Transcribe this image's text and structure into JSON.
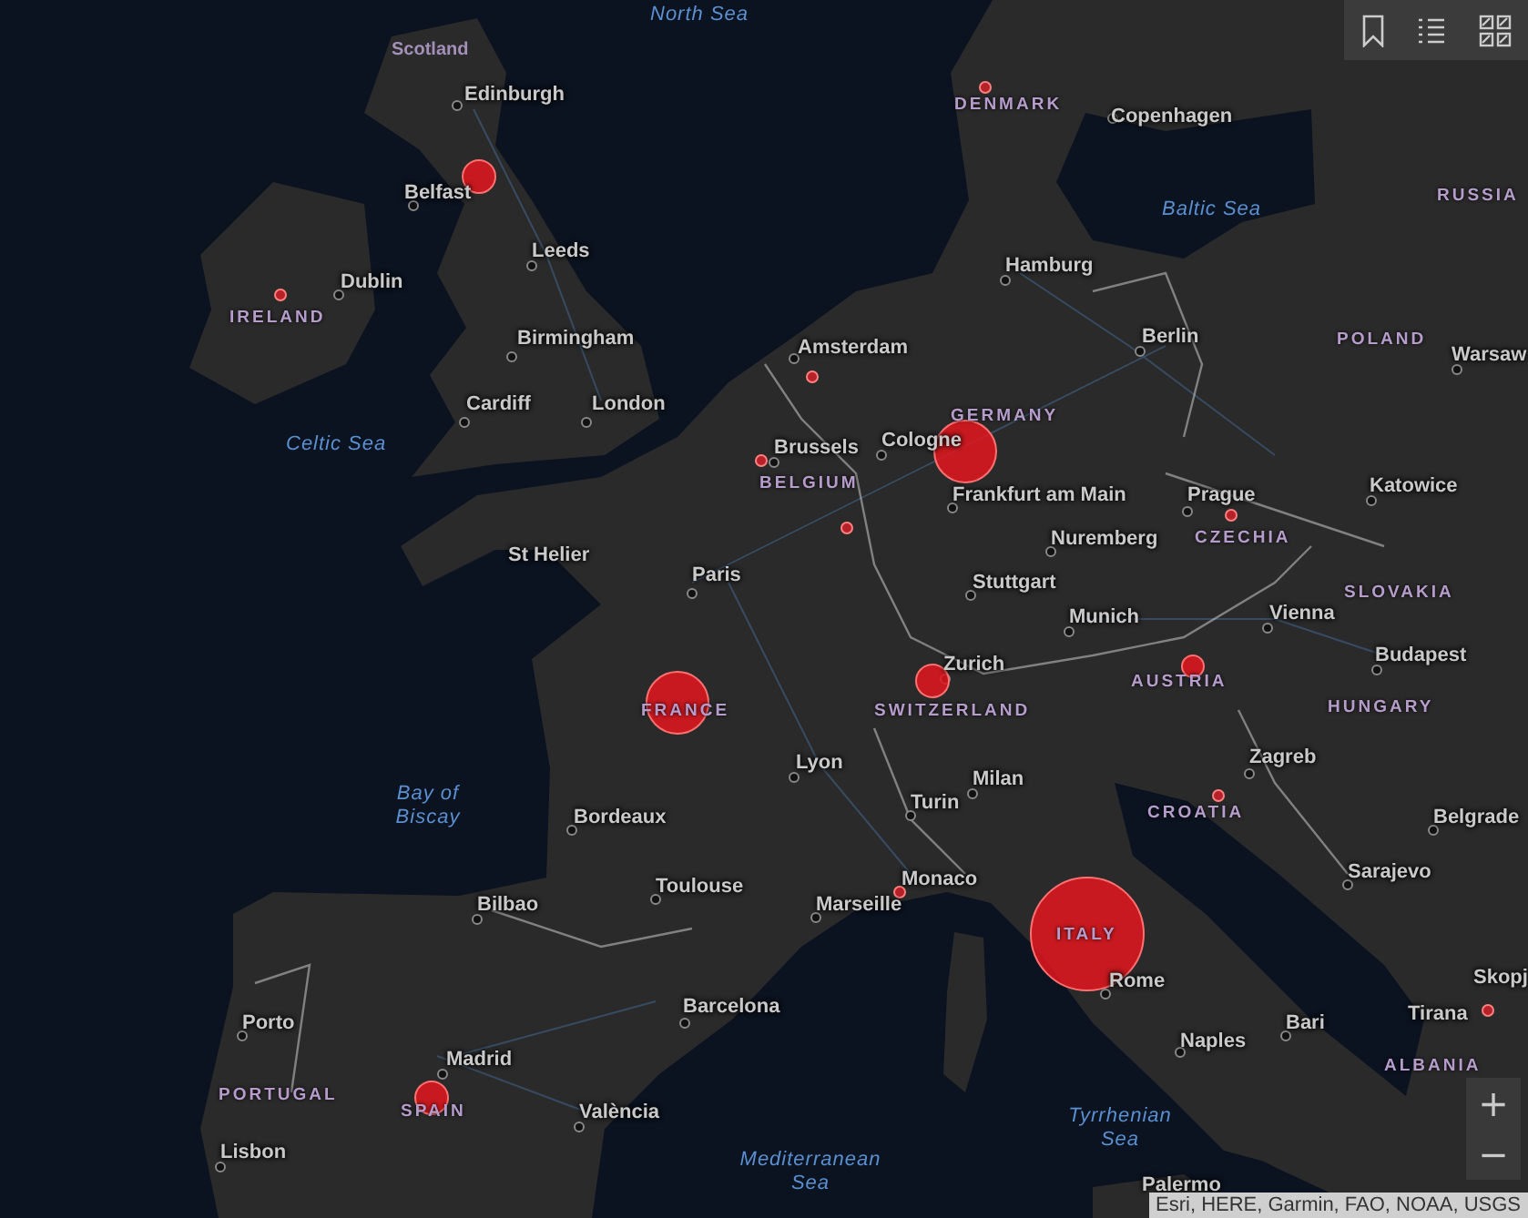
{
  "map": {
    "labels": [
      {
        "text": "North Sea",
        "kind": "sea"
      },
      {
        "text": "Scotland",
        "kind": "region"
      },
      {
        "text": "Edinburgh",
        "kind": "city"
      },
      {
        "text": "DENMARK",
        "kind": "country"
      },
      {
        "text": "Copenhagen",
        "kind": "city"
      },
      {
        "text": "Belfast",
        "kind": "city"
      },
      {
        "text": "RUSSIA",
        "kind": "country"
      },
      {
        "text": "Baltic Sea",
        "kind": "sea"
      },
      {
        "text": "Leeds",
        "kind": "city"
      },
      {
        "text": "Hamburg",
        "kind": "city"
      },
      {
        "text": "Dublin",
        "kind": "city"
      },
      {
        "text": "IRELAND",
        "kind": "country"
      },
      {
        "text": "Birmingham",
        "kind": "city"
      },
      {
        "text": "Berlin",
        "kind": "city"
      },
      {
        "text": "POLAND",
        "kind": "country"
      },
      {
        "text": "Amsterdam",
        "kind": "city"
      },
      {
        "text": "Warsaw",
        "kind": "city"
      },
      {
        "text": "Cardiff",
        "kind": "city"
      },
      {
        "text": "London",
        "kind": "city"
      },
      {
        "text": "GERMANY",
        "kind": "country"
      },
      {
        "text": "Celtic Sea",
        "kind": "sea"
      },
      {
        "text": "Brussels",
        "kind": "city"
      },
      {
        "text": "Cologne",
        "kind": "city"
      },
      {
        "text": "BELGIUM",
        "kind": "country"
      },
      {
        "text": "Katowice",
        "kind": "city"
      },
      {
        "text": "Frankfurt am Main",
        "kind": "city"
      },
      {
        "text": "Prague",
        "kind": "city"
      },
      {
        "text": "Nuremberg",
        "kind": "city"
      },
      {
        "text": "CZECHIA",
        "kind": "country"
      },
      {
        "text": "St Helier",
        "kind": "city"
      },
      {
        "text": "Paris",
        "kind": "city"
      },
      {
        "text": "Stuttgart",
        "kind": "city"
      },
      {
        "text": "SLOVAKIA",
        "kind": "country"
      },
      {
        "text": "Vienna",
        "kind": "city"
      },
      {
        "text": "Munich",
        "kind": "city"
      },
      {
        "text": "Budapest",
        "kind": "city"
      },
      {
        "text": "Zurich",
        "kind": "city"
      },
      {
        "text": "AUSTRIA",
        "kind": "country"
      },
      {
        "text": "FRANCE",
        "kind": "country"
      },
      {
        "text": "SWITZERLAND",
        "kind": "country"
      },
      {
        "text": "HUNGARY",
        "kind": "country"
      },
      {
        "text": "Zagreb",
        "kind": "city"
      },
      {
        "text": "Lyon",
        "kind": "city"
      },
      {
        "text": "Milan",
        "kind": "city"
      },
      {
        "text": "Bay of Biscay",
        "kind": "sea"
      },
      {
        "text": "Turin",
        "kind": "city"
      },
      {
        "text": "Bordeaux",
        "kind": "city"
      },
      {
        "text": "CROATIA",
        "kind": "country"
      },
      {
        "text": "Belgrade",
        "kind": "city"
      },
      {
        "text": "Sarajevo",
        "kind": "city"
      },
      {
        "text": "Monaco",
        "kind": "city"
      },
      {
        "text": "Toulouse",
        "kind": "city"
      },
      {
        "text": "Marseille",
        "kind": "city"
      },
      {
        "text": "Bilbao",
        "kind": "city"
      },
      {
        "text": "ITALY",
        "kind": "country"
      },
      {
        "text": "Skopj",
        "kind": "city"
      },
      {
        "text": "Rome",
        "kind": "city"
      },
      {
        "text": "Barcelona",
        "kind": "city"
      },
      {
        "text": "Tirana",
        "kind": "city"
      },
      {
        "text": "Porto",
        "kind": "city"
      },
      {
        "text": "Bari",
        "kind": "city"
      },
      {
        "text": "Naples",
        "kind": "city"
      },
      {
        "text": "Madrid",
        "kind": "city"
      },
      {
        "text": "ALBANIA",
        "kind": "country"
      },
      {
        "text": "PORTUGAL",
        "kind": "country"
      },
      {
        "text": "SPAIN",
        "kind": "country"
      },
      {
        "text": "València",
        "kind": "city"
      },
      {
        "text": "Tyrrhenian Sea",
        "kind": "sea"
      },
      {
        "text": "Mediterranean Sea",
        "kind": "sea"
      },
      {
        "text": "Lisbon",
        "kind": "city"
      },
      {
        "text": "Palermo",
        "kind": "city"
      }
    ],
    "markers": [
      {
        "kind": "medium"
      },
      {
        "kind": "large"
      },
      {
        "kind": "large"
      },
      {
        "kind": "medium"
      },
      {
        "kind": "small"
      },
      {
        "kind": "huge"
      },
      {
        "kind": "medium"
      },
      {
        "kind": "dot"
      },
      {
        "kind": "dot"
      },
      {
        "kind": "dot"
      },
      {
        "kind": "dot"
      },
      {
        "kind": "dot"
      },
      {
        "kind": "dot"
      },
      {
        "kind": "dot"
      },
      {
        "kind": "dot"
      },
      {
        "kind": "dot"
      }
    ]
  },
  "zoom_controls": {
    "zoom_in": "+",
    "zoom_out": "−"
  },
  "attribution": "Esri, HERE, Garmin, FAO, NOAA, USGS"
}
